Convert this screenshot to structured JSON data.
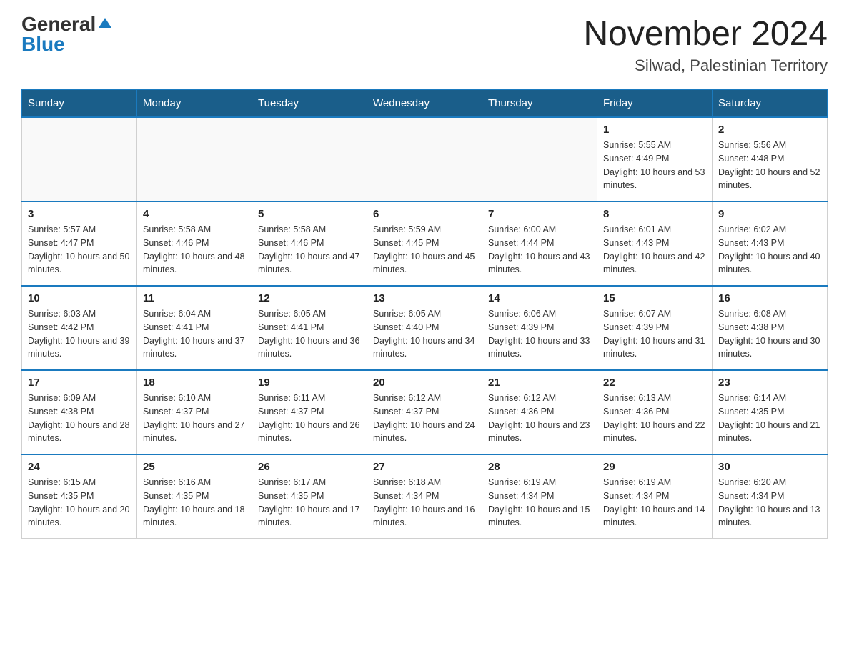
{
  "header": {
    "logo_general": "General",
    "logo_blue": "Blue",
    "title": "November 2024",
    "subtitle": "Silwad, Palestinian Territory"
  },
  "weekdays": [
    "Sunday",
    "Monday",
    "Tuesday",
    "Wednesday",
    "Thursday",
    "Friday",
    "Saturday"
  ],
  "weeks": [
    [
      {
        "day": "",
        "info": ""
      },
      {
        "day": "",
        "info": ""
      },
      {
        "day": "",
        "info": ""
      },
      {
        "day": "",
        "info": ""
      },
      {
        "day": "",
        "info": ""
      },
      {
        "day": "1",
        "info": "Sunrise: 5:55 AM\nSunset: 4:49 PM\nDaylight: 10 hours and 53 minutes."
      },
      {
        "day": "2",
        "info": "Sunrise: 5:56 AM\nSunset: 4:48 PM\nDaylight: 10 hours and 52 minutes."
      }
    ],
    [
      {
        "day": "3",
        "info": "Sunrise: 5:57 AM\nSunset: 4:47 PM\nDaylight: 10 hours and 50 minutes."
      },
      {
        "day": "4",
        "info": "Sunrise: 5:58 AM\nSunset: 4:46 PM\nDaylight: 10 hours and 48 minutes."
      },
      {
        "day": "5",
        "info": "Sunrise: 5:58 AM\nSunset: 4:46 PM\nDaylight: 10 hours and 47 minutes."
      },
      {
        "day": "6",
        "info": "Sunrise: 5:59 AM\nSunset: 4:45 PM\nDaylight: 10 hours and 45 minutes."
      },
      {
        "day": "7",
        "info": "Sunrise: 6:00 AM\nSunset: 4:44 PM\nDaylight: 10 hours and 43 minutes."
      },
      {
        "day": "8",
        "info": "Sunrise: 6:01 AM\nSunset: 4:43 PM\nDaylight: 10 hours and 42 minutes."
      },
      {
        "day": "9",
        "info": "Sunrise: 6:02 AM\nSunset: 4:43 PM\nDaylight: 10 hours and 40 minutes."
      }
    ],
    [
      {
        "day": "10",
        "info": "Sunrise: 6:03 AM\nSunset: 4:42 PM\nDaylight: 10 hours and 39 minutes."
      },
      {
        "day": "11",
        "info": "Sunrise: 6:04 AM\nSunset: 4:41 PM\nDaylight: 10 hours and 37 minutes."
      },
      {
        "day": "12",
        "info": "Sunrise: 6:05 AM\nSunset: 4:41 PM\nDaylight: 10 hours and 36 minutes."
      },
      {
        "day": "13",
        "info": "Sunrise: 6:05 AM\nSunset: 4:40 PM\nDaylight: 10 hours and 34 minutes."
      },
      {
        "day": "14",
        "info": "Sunrise: 6:06 AM\nSunset: 4:39 PM\nDaylight: 10 hours and 33 minutes."
      },
      {
        "day": "15",
        "info": "Sunrise: 6:07 AM\nSunset: 4:39 PM\nDaylight: 10 hours and 31 minutes."
      },
      {
        "day": "16",
        "info": "Sunrise: 6:08 AM\nSunset: 4:38 PM\nDaylight: 10 hours and 30 minutes."
      }
    ],
    [
      {
        "day": "17",
        "info": "Sunrise: 6:09 AM\nSunset: 4:38 PM\nDaylight: 10 hours and 28 minutes."
      },
      {
        "day": "18",
        "info": "Sunrise: 6:10 AM\nSunset: 4:37 PM\nDaylight: 10 hours and 27 minutes."
      },
      {
        "day": "19",
        "info": "Sunrise: 6:11 AM\nSunset: 4:37 PM\nDaylight: 10 hours and 26 minutes."
      },
      {
        "day": "20",
        "info": "Sunrise: 6:12 AM\nSunset: 4:37 PM\nDaylight: 10 hours and 24 minutes."
      },
      {
        "day": "21",
        "info": "Sunrise: 6:12 AM\nSunset: 4:36 PM\nDaylight: 10 hours and 23 minutes."
      },
      {
        "day": "22",
        "info": "Sunrise: 6:13 AM\nSunset: 4:36 PM\nDaylight: 10 hours and 22 minutes."
      },
      {
        "day": "23",
        "info": "Sunrise: 6:14 AM\nSunset: 4:35 PM\nDaylight: 10 hours and 21 minutes."
      }
    ],
    [
      {
        "day": "24",
        "info": "Sunrise: 6:15 AM\nSunset: 4:35 PM\nDaylight: 10 hours and 20 minutes."
      },
      {
        "day": "25",
        "info": "Sunrise: 6:16 AM\nSunset: 4:35 PM\nDaylight: 10 hours and 18 minutes."
      },
      {
        "day": "26",
        "info": "Sunrise: 6:17 AM\nSunset: 4:35 PM\nDaylight: 10 hours and 17 minutes."
      },
      {
        "day": "27",
        "info": "Sunrise: 6:18 AM\nSunset: 4:34 PM\nDaylight: 10 hours and 16 minutes."
      },
      {
        "day": "28",
        "info": "Sunrise: 6:19 AM\nSunset: 4:34 PM\nDaylight: 10 hours and 15 minutes."
      },
      {
        "day": "29",
        "info": "Sunrise: 6:19 AM\nSunset: 4:34 PM\nDaylight: 10 hours and 14 minutes."
      },
      {
        "day": "30",
        "info": "Sunrise: 6:20 AM\nSunset: 4:34 PM\nDaylight: 10 hours and 13 minutes."
      }
    ]
  ]
}
